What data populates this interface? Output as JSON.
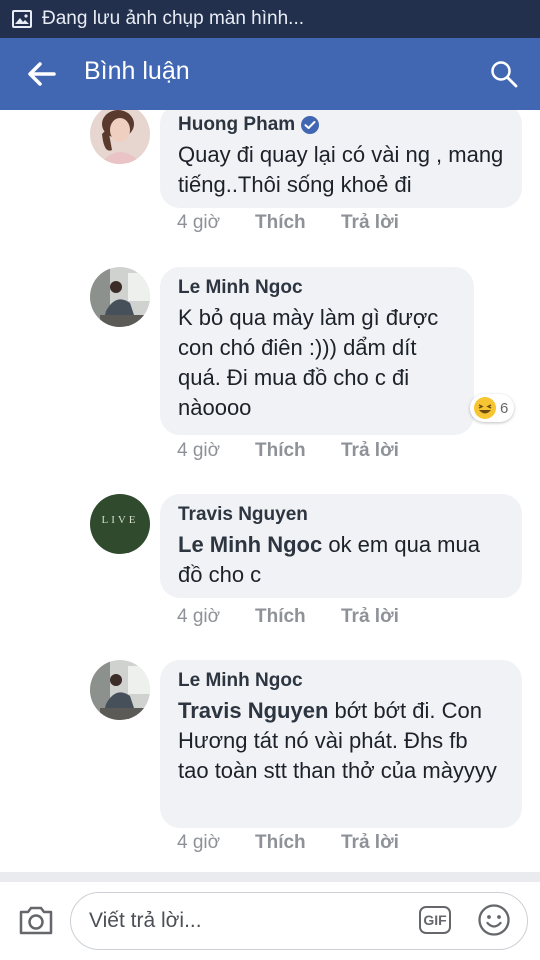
{
  "status_bar": {
    "notification": "Đang lưu ảnh chụp màn hình..."
  },
  "app_bar": {
    "title": "Bình luận"
  },
  "comments": [
    {
      "author": "Huong Pham",
      "verified": true,
      "text": "Quay đi quay lại có vài ng , mang tiếng..Thôi sống khoẻ đi",
      "time": "4 giờ",
      "like": "Thích",
      "reply": "Trả lời"
    },
    {
      "author": "Le Minh Ngoc",
      "text": "K bỏ qua mày làm gì được con chó điên :))) dẩm dít quá. Đi mua đồ cho c đi nàoooo",
      "reaction": {
        "emoji": "haha-icon",
        "count": "6"
      },
      "time": "4 giờ",
      "like": "Thích",
      "reply": "Trả lời"
    },
    {
      "author": "Travis Nguyen",
      "avatar_text": "LIVE",
      "mention": "Le Minh Ngoc",
      "text": " ok em qua mua đồ cho c",
      "time": "4 giờ",
      "like": "Thích",
      "reply": "Trả lời"
    },
    {
      "author": "Le Minh Ngoc",
      "mention": "Travis Nguyen",
      "text": " bớt bớt đi. Con Hương tát nó vài phát. Đhs fb tao toàn stt than thở của màyyyy",
      "time": "4 giờ",
      "like": "Thích",
      "reply": "Trả lời"
    }
  ],
  "composer": {
    "placeholder": "Viết trả lời...",
    "gif_label": "GIF"
  },
  "colors": {
    "app_bar": "#4267b2",
    "status_bar": "#22304d",
    "bubble": "#f0f2f5"
  }
}
